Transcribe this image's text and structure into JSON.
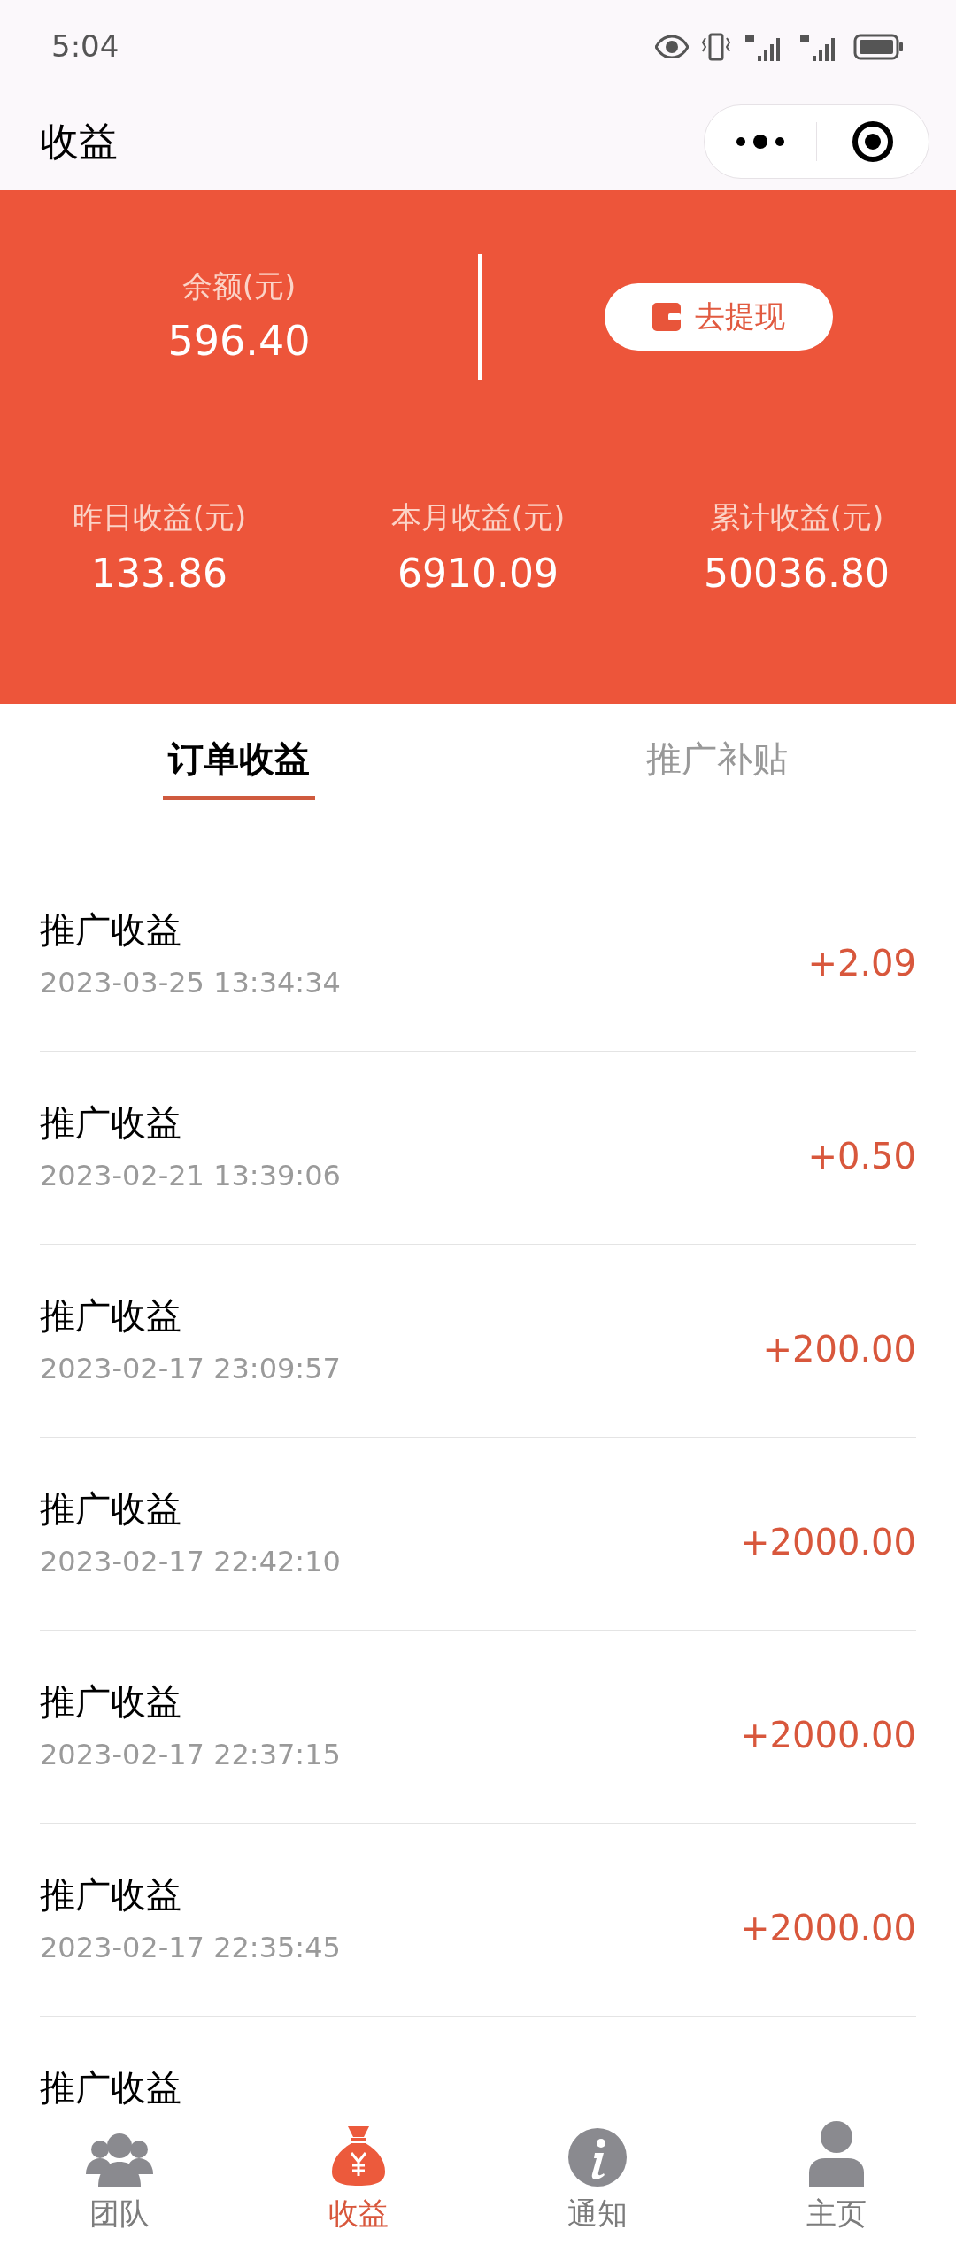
{
  "status_bar": {
    "time": "5:04"
  },
  "header": {
    "title": "收益"
  },
  "balance": {
    "label": "余额(元)",
    "value": "596.40",
    "withdraw_button": "去提现"
  },
  "stats": [
    {
      "label": "昨日收益(元)",
      "value": "133.86"
    },
    {
      "label": "本月收益(元)",
      "value": "6910.09"
    },
    {
      "label": "累计收益(元)",
      "value": "50036.80"
    }
  ],
  "tabs": [
    {
      "label": "订单收益",
      "selected": true
    },
    {
      "label": "推广补贴",
      "selected": false
    }
  ],
  "records": [
    {
      "title": "推广收益",
      "time": "2023-03-25 13:34:34",
      "amount": "+2.09"
    },
    {
      "title": "推广收益",
      "time": "2023-02-21 13:39:06",
      "amount": "+0.50"
    },
    {
      "title": "推广收益",
      "time": "2023-02-17 23:09:57",
      "amount": "+200.00"
    },
    {
      "title": "推广收益",
      "time": "2023-02-17 22:42:10",
      "amount": "+2000.00"
    },
    {
      "title": "推广收益",
      "time": "2023-02-17 22:37:15",
      "amount": "+2000.00"
    },
    {
      "title": "推广收益",
      "time": "2023-02-17 22:35:45",
      "amount": "+2000.00"
    },
    {
      "title": "推广收益"
    }
  ],
  "bottom_nav": [
    {
      "kind": "team",
      "label": "团队",
      "selected": false
    },
    {
      "kind": "earnings",
      "label": "收益",
      "selected": true
    },
    {
      "kind": "notice",
      "label": "通知",
      "selected": false
    },
    {
      "kind": "home",
      "label": "主页",
      "selected": false
    }
  ]
}
